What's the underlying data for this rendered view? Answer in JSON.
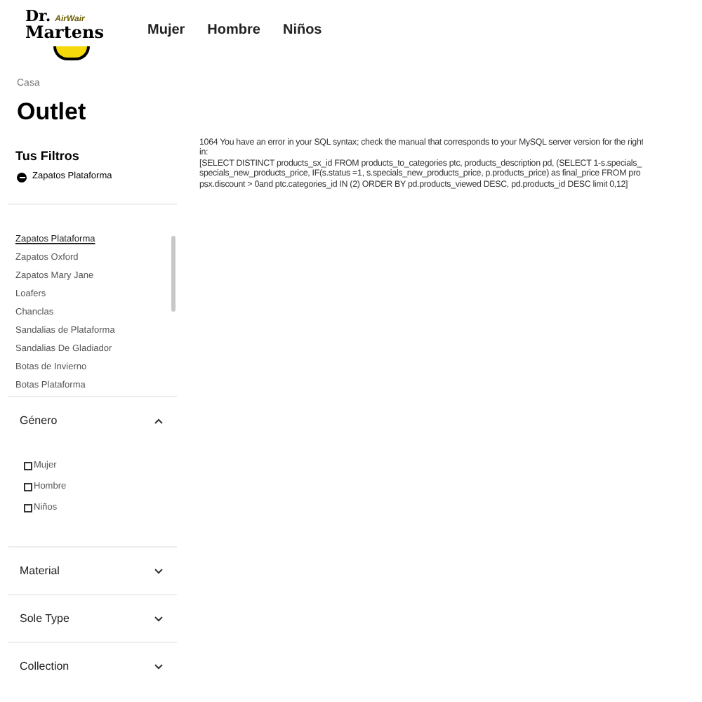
{
  "header": {
    "logo": {
      "line_1": "Dr.",
      "line_2": "AirWair",
      "line_3": "Martens"
    },
    "nav": [
      "Mujer",
      "Hombre",
      "Niños"
    ]
  },
  "breadcrumb": [
    "Casa"
  ],
  "page_title": "Outlet",
  "filters": {
    "title": "Tus Filtros",
    "active": [
      "Zapatos Plataforma"
    ],
    "categories": [
      {
        "label": "Zapatos Plataforma",
        "selected": true
      },
      {
        "label": "Zapatos Oxford",
        "selected": false
      },
      {
        "label": "Zapatos Mary Jane",
        "selected": false
      },
      {
        "label": "Loafers",
        "selected": false
      },
      {
        "label": "Chanclas",
        "selected": false
      },
      {
        "label": "Sandalias de Plataforma",
        "selected": false
      },
      {
        "label": "Sandalias De Gladiador",
        "selected": false
      },
      {
        "label": "Botas de Invierno",
        "selected": false
      },
      {
        "label": "Botas Plataforma",
        "selected": false
      }
    ],
    "sections": [
      {
        "title": "Género",
        "expanded": true,
        "options": [
          {
            "label": "Mujer",
            "checked": false
          },
          {
            "label": "Hombre",
            "checked": false
          },
          {
            "label": "Niños",
            "checked": false
          }
        ]
      },
      {
        "title": "Material",
        "expanded": false
      },
      {
        "title": "Sole Type",
        "expanded": false
      },
      {
        "title": "Collection",
        "expanded": false
      }
    ]
  },
  "error_message": [
    "1064 You have an error in your SQL syntax; check the manual that corresponds to your MySQL server version for the right",
    "in:",
    "[SELECT DISTINCT products_sx_id FROM products_to_categories ptc, products_description pd, (SELECT 1-s.specials_",
    "specials_new_products_price, IF(s.status =1, s.specials_new_products_price, p.products_price) as final_price FROM pro",
    "psx.discount > 0and ptc.categories_id IN (2) ORDER BY pd.products_viewed DESC, pd.products_id DESC limit 0,12]"
  ]
}
